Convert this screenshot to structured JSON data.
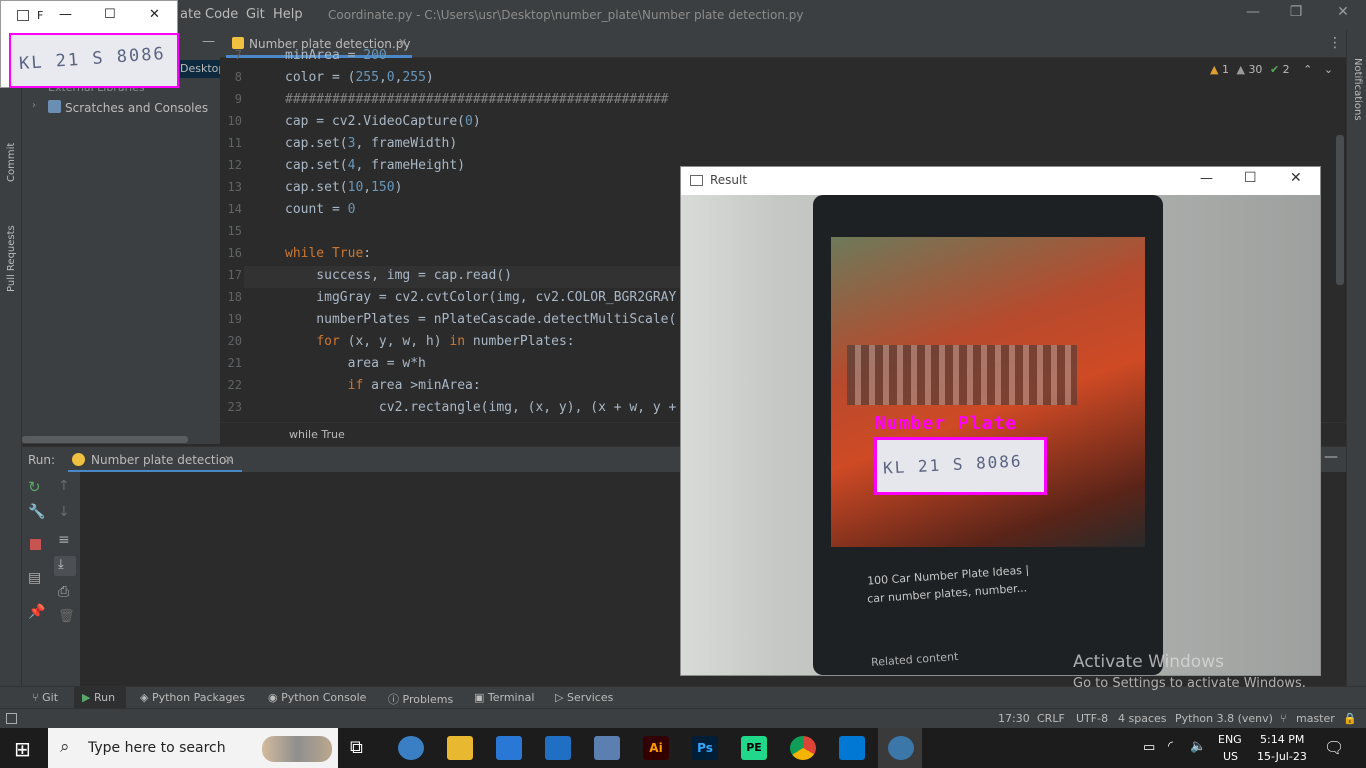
{
  "topbar": {
    "menu": [
      "ate",
      "Code",
      "Git",
      "Help"
    ],
    "title_path": "Coordinate.py - C:\\Users\\usr\\Desktop\\number_plate\\Number plate detection.py",
    "minimize": "—",
    "restore": "❐",
    "close": "✕"
  },
  "mini_window": {
    "title": "F",
    "minimize": "—",
    "maximize": "☐",
    "close": "✕",
    "plate_text": "KL 21 S 8086"
  },
  "project": {
    "path_fragment": "Desktop\\",
    "external_libraries": "External Libraries",
    "scratches": "Scratches and Consoles"
  },
  "left_strip": {
    "commit": "Commit",
    "pull_requests": "Pull Requests"
  },
  "editor": {
    "tab_label": "Number plate detection.py",
    "inspections": {
      "warnings": "1",
      "weak_warnings": "30",
      "typos": "2"
    },
    "line_numbers": [
      "7",
      "8",
      "9",
      "10",
      "11",
      "12",
      "13",
      "14",
      "15",
      "16",
      "17",
      "18",
      "19",
      "20",
      "21",
      "22",
      "23"
    ],
    "code": [
      "minArea = 200",
      "color = (255,0,255)",
      "#################################################",
      "cap = cv2.VideoCapture(0)",
      "cap.set(3, frameWidth)",
      "cap.set(4, frameHeight)",
      "cap.set(10,150)",
      "count = 0",
      "",
      "while True:",
      "    success, img = cap.read()",
      "    imgGray = cv2.cvtColor(img, cv2.COLOR_BGR2GRAY",
      "    numberPlates = nPlateCascade.detectMultiScale(",
      "    for (x, y, w, h) in numberPlates:",
      "        area = w*h",
      "        if area >minArea:",
      "            cv2.rectangle(img, (x, y), (x + w, y +"
    ],
    "breadcrumb": "while True"
  },
  "result_window": {
    "title": "Result",
    "minimize": "—",
    "maximize": "☐",
    "close": "✕",
    "label": "Number Plate",
    "plate_text": "KL 21 S 8086",
    "phone_text_1": "100 Car Number Plate Ideas |",
    "phone_text_2": "car number plates, number...",
    "phone_text_3": "Related content"
  },
  "watermark": {
    "line1": "Activate Windows",
    "line2": "Go to Settings to activate Windows."
  },
  "run_panel": {
    "label": "Run:",
    "config": "Number plate detection"
  },
  "tool_windows": [
    "Git",
    "Run",
    "Python Packages",
    "Python Console",
    "Problems",
    "Terminal",
    "Services"
  ],
  "status": {
    "position": "17:30",
    "line_sep": "CRLF",
    "encoding": "UTF-8",
    "indent": "4 spaces",
    "interpreter": "Python 3.8 (venv)",
    "branch": "master",
    "notifications": "Notifications"
  },
  "taskbar": {
    "search_placeholder": "Type here to search",
    "lang": "ENG",
    "region": "US",
    "time": "5:14 PM",
    "date": "15-Jul-23"
  },
  "colors": {
    "accent_magenta": "#ff00ff",
    "ide_bg": "#2b2b2b",
    "panel_bg": "#3c3f41"
  }
}
